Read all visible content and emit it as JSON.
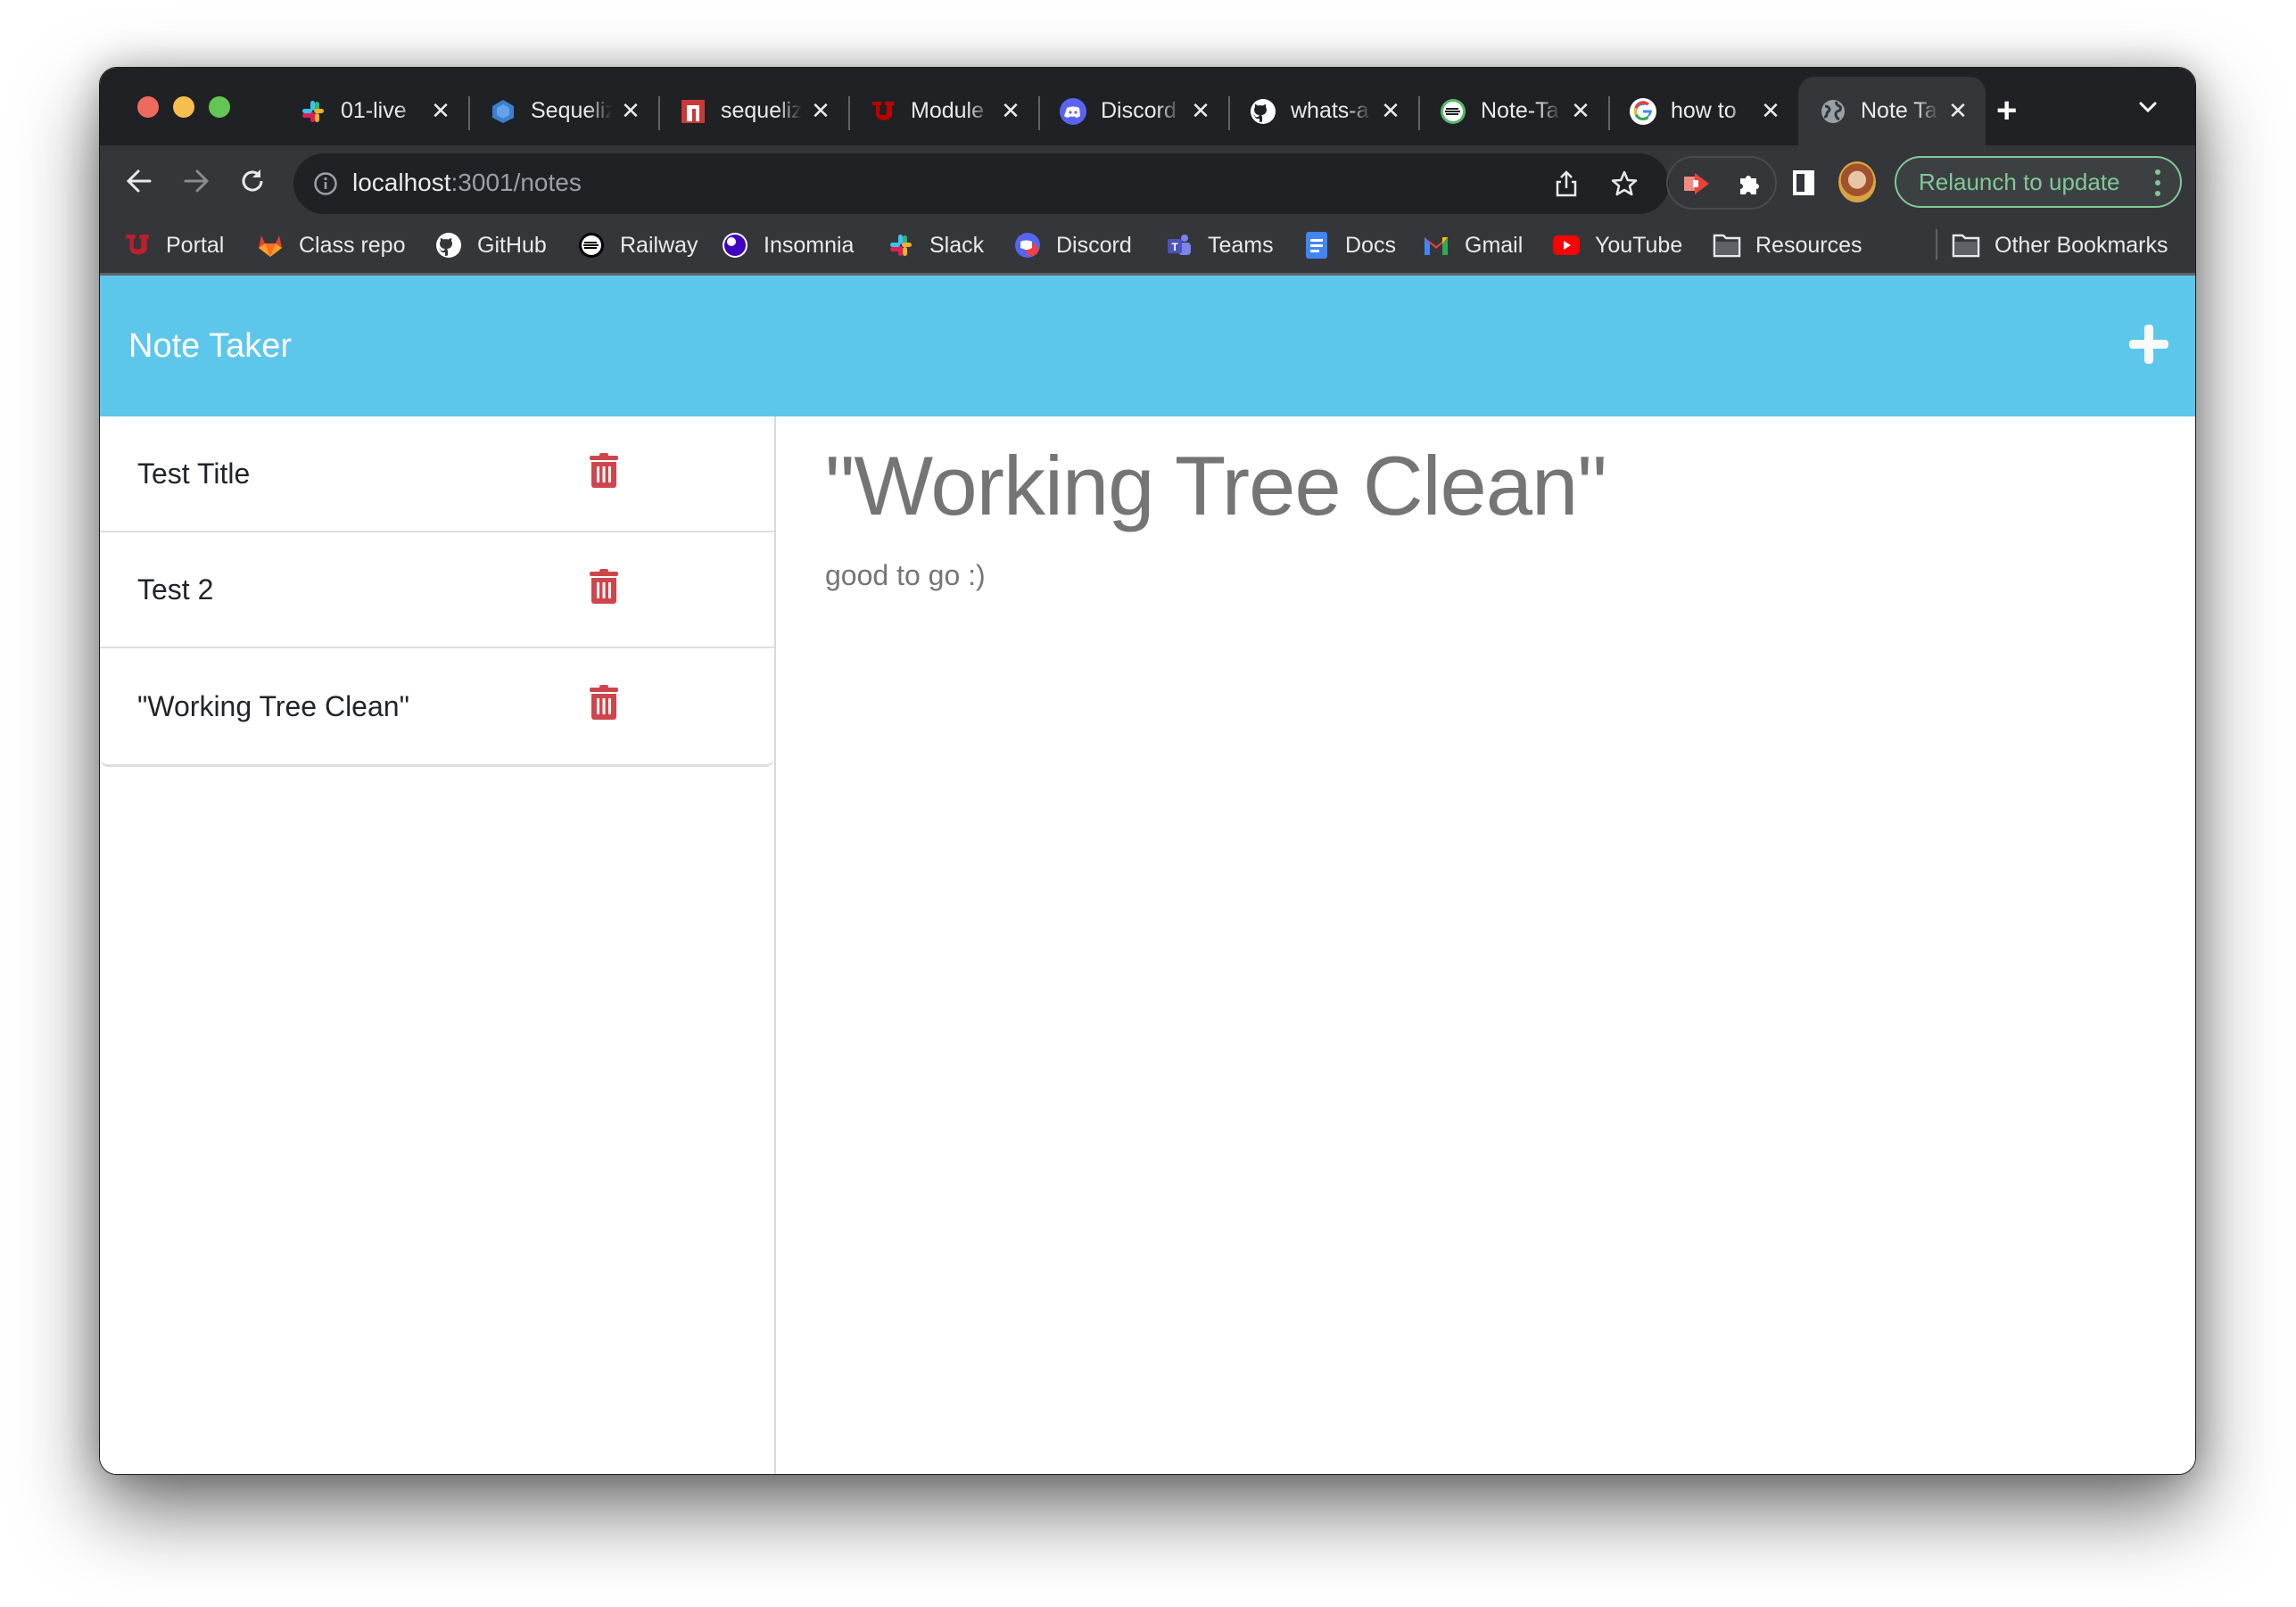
{
  "browser": {
    "tabs": [
      {
        "title": "01-live",
        "icon": "slack-icon",
        "active": false
      },
      {
        "title": "Sequelize",
        "icon": "sequelize-icon",
        "active": false
      },
      {
        "title": "sequelize",
        "icon": "npm-icon",
        "active": false
      },
      {
        "title": "Module",
        "icon": "utah-u-icon",
        "active": false
      },
      {
        "title": "Discord",
        "icon": "discord-icon",
        "active": false
      },
      {
        "title": "whats-a",
        "icon": "github-icon",
        "active": false
      },
      {
        "title": "Note-Ta",
        "icon": "railway-icon",
        "active": false
      },
      {
        "title": "how to",
        "icon": "google-icon",
        "active": false
      },
      {
        "title": "Note Ta",
        "icon": "globe-icon",
        "active": true
      }
    ],
    "tab_close_glyph": "✕",
    "new_tab_glyph": "+",
    "address": {
      "host": "localhost",
      "rest": ":3001/notes"
    },
    "relaunch_label": "Relaunch to update",
    "bookmarks": [
      {
        "label": "Portal",
        "icon": "utah-u-icon"
      },
      {
        "label": "Class repo",
        "icon": "gitlab-icon"
      },
      {
        "label": "GitHub",
        "icon": "github-icon"
      },
      {
        "label": "Railway",
        "icon": "railway-icon"
      },
      {
        "label": "Insomnia",
        "icon": "insomnia-icon"
      },
      {
        "label": "Slack",
        "icon": "slack-icon"
      },
      {
        "label": "Discord",
        "icon": "discord-icon"
      },
      {
        "label": "Teams",
        "icon": "teams-icon"
      },
      {
        "label": "Docs",
        "icon": "docs-icon"
      },
      {
        "label": "Gmail",
        "icon": "gmail-icon"
      },
      {
        "label": "YouTube",
        "icon": "youtube-icon"
      },
      {
        "label": "Resources",
        "icon": "folder-icon"
      }
    ],
    "other_bookmarks": "Other Bookmarks"
  },
  "app": {
    "title": "Note Taker",
    "accent_color": "#5dc7eb",
    "delete_color": "#d0454c",
    "notes": [
      {
        "title": "Test Title"
      },
      {
        "title": "Test 2"
      },
      {
        "title": "\"Working Tree Clean\""
      }
    ],
    "active_note": {
      "title": "\"Working Tree Clean\"",
      "text": "good to go :)"
    }
  }
}
